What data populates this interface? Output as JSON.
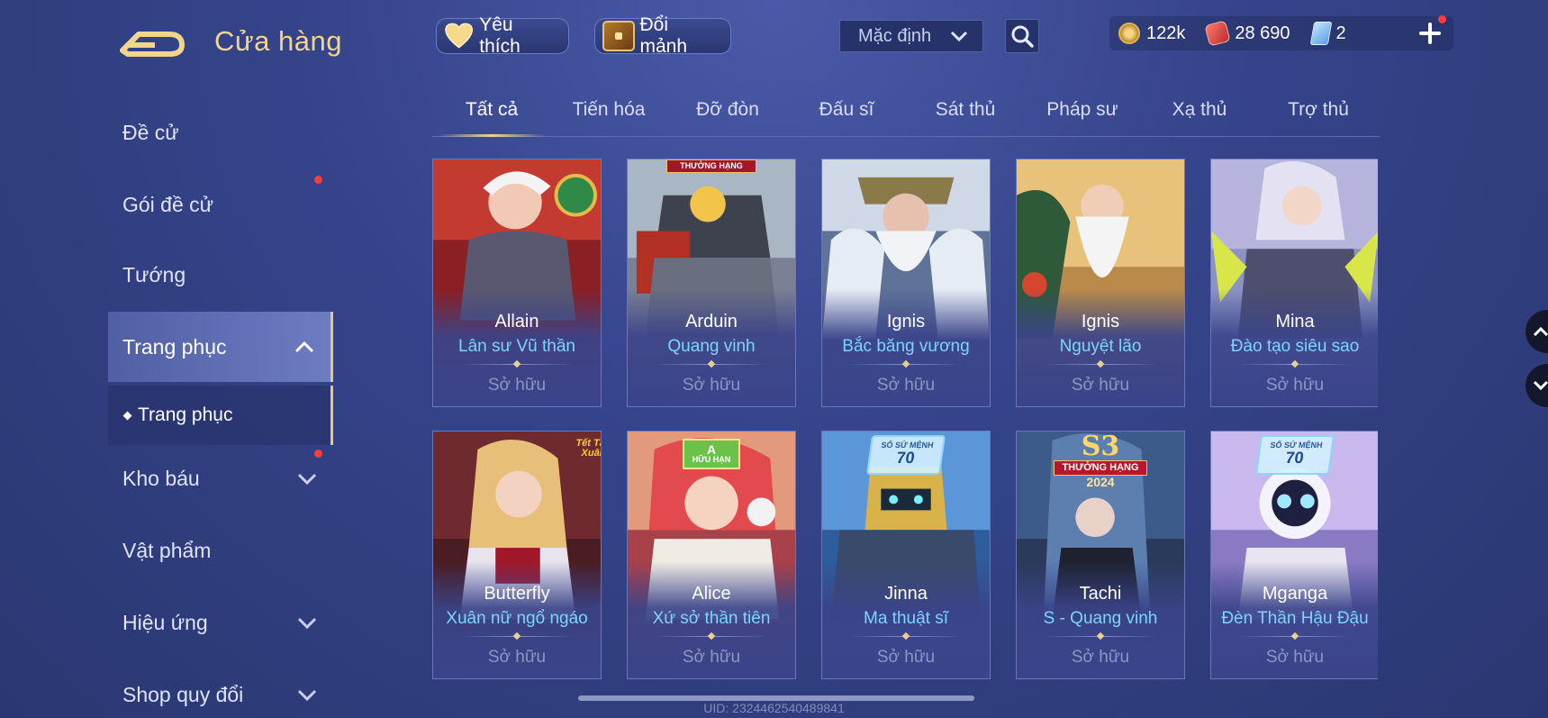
{
  "header": {
    "title": "Cửa hàng",
    "favorite_label": "Yêu thích",
    "exchange_label": "Đổi mảnh",
    "sort_select": "Mặc định",
    "currency": {
      "gold": "122k",
      "vouchers": "28 690",
      "cards": "2"
    },
    "colors": {
      "title": "#f1d58c",
      "accent": "#e8c67a",
      "notification": "#ff3b3b"
    }
  },
  "sidebar": {
    "items": [
      {
        "label": "Đề cử"
      },
      {
        "label": "Gói đề cử"
      },
      {
        "label": "Tướng"
      },
      {
        "label": "Trang phục"
      },
      {
        "label": "Kho báu"
      },
      {
        "label": "Vật phẩm"
      },
      {
        "label": "Hiệu ứng"
      },
      {
        "label": "Shop quy đổi"
      }
    ],
    "sub_item": "Trang phục"
  },
  "tabs": [
    "Tất cả",
    "Tiến hóa",
    "Đỡ đòn",
    "Đấu sĩ",
    "Sát thủ",
    "Pháp sư",
    "Xạ thủ",
    "Trợ thủ"
  ],
  "cards": [
    {
      "hero": "Allain",
      "skin": "Lân sư Vũ thần",
      "status": "Sở hữu"
    },
    {
      "hero": "Arduin",
      "skin": "Quang vinh",
      "status": "Sở hữu"
    },
    {
      "hero": "Ignis",
      "skin": "Bắc băng vương",
      "status": "Sở hữu"
    },
    {
      "hero": "Ignis",
      "skin": "Nguyệt lão",
      "status": "Sở hữu"
    },
    {
      "hero": "Mina",
      "skin": "Đào tạo siêu sao",
      "status": "Sở hữu"
    },
    {
      "hero": "Butterfly",
      "skin": "Xuân nữ ngổ ngáo",
      "status": "Sở hữu"
    },
    {
      "hero": "Alice",
      "skin": "Xứ sở thần tiên",
      "status": "Sở hữu"
    },
    {
      "hero": "Jinna",
      "skin": "Ma thuật sĩ",
      "status": "Sở hữu"
    },
    {
      "hero": "Tachi",
      "skin": "S - Quang vinh",
      "status": "Sở hữu"
    },
    {
      "hero": "Mganga",
      "skin": "Đèn Thần Hậu Đậu",
      "status": "Sở hữu"
    }
  ],
  "badges": {
    "rank": "THƯỞNG HẠNG",
    "season": "S3",
    "season_rank": "THƯỞNG HẠNG",
    "season_year": "2024",
    "mission_label": "SỔ SỨ MỆNH",
    "mission_level": "70",
    "limited_tier": "A",
    "limited_label": "HỮU HẠN",
    "tet_label": "Tết Tân Xuân"
  },
  "footer": {
    "uid": "UID: 2324462540489841"
  }
}
